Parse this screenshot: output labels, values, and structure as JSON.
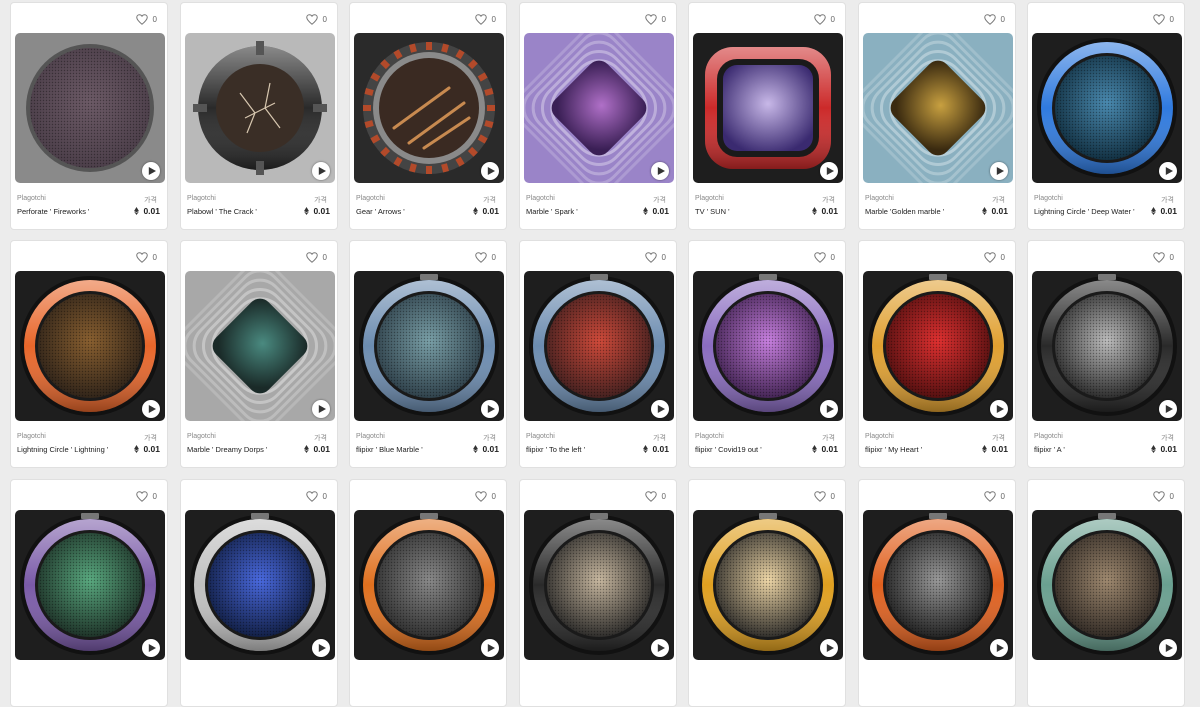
{
  "grid": {
    "items": [
      {
        "likes": "0",
        "creator": "Plagotchi",
        "price_label": "가격",
        "name": "Perforate ' Fireworks '",
        "price": "0.01",
        "style": "perforate",
        "colors": {
          "bg": "#8a8a8a",
          "ring": "#3a3a3a",
          "screen": "#4a3d48",
          "accent": "#6c5a66"
        }
      },
      {
        "likes": "0",
        "creator": "Plagotchi",
        "price_label": "가격",
        "name": "Plabowl ' The Crack '",
        "price": "0.01",
        "style": "bowl",
        "colors": {
          "bg": "#b9b9b9",
          "ring": "#2a2a2a",
          "screen": "#3a2e26",
          "accent": "#d8c8b0"
        }
      },
      {
        "likes": "0",
        "creator": "Plagotchi",
        "price_label": "가격",
        "name": "Gear ' Arrows '",
        "price": "0.01",
        "style": "gear",
        "colors": {
          "bg": "#2a2a2a",
          "ring": "#b34a2a",
          "screen": "#3a2a22",
          "accent": "#c88a50"
        }
      },
      {
        "likes": "0",
        "creator": "Plagotchi",
        "price_label": "가격",
        "name": "Marble ' Spark '",
        "price": "0.01",
        "style": "marble",
        "colors": {
          "bg": "#9a84c8",
          "ring": "#7c64ae",
          "screen": "#3a1f55",
          "accent": "#b070c8"
        }
      },
      {
        "likes": "0",
        "creator": "Plagotchi",
        "price_label": "가격",
        "name": "TV ' SUN '",
        "price": "0.01",
        "style": "tv",
        "colors": {
          "bg": "#1e1e1e",
          "ring": "#cc2a2a",
          "screen": "#3a2a70",
          "accent": "#c8b8e8"
        }
      },
      {
        "likes": "0",
        "creator": "Plagotchi",
        "price_label": "가격",
        "name": "Marble 'Golden marble '",
        "price": "0.01",
        "style": "marble",
        "colors": {
          "bg": "#8ab0c0",
          "ring": "#6a94a8",
          "screen": "#3a2a10",
          "accent": "#c8a040"
        }
      },
      {
        "likes": "0",
        "creator": "Plagotchi",
        "price_label": "가격",
        "name": "Lightning Circle ' Deep Water '",
        "price": "0.01",
        "style": "circle",
        "colors": {
          "bg": "#1e1e1e",
          "ring": "#2f7adf",
          "screen": "#0e2a3a",
          "accent": "#4a8ab0"
        }
      },
      {
        "likes": "0",
        "creator": "Plagotchi",
        "price_label": "가격",
        "name": "Lightning Circle ' Lightning '",
        "price": "0.01",
        "style": "circle",
        "colors": {
          "bg": "#1e1e1e",
          "ring": "#e8662a",
          "screen": "#2a2018",
          "accent": "#8a6030"
        }
      },
      {
        "likes": "0",
        "creator": "Plagotchi",
        "price_label": "가격",
        "name": "Marble ' Dreamy Dorps '",
        "price": "0.01",
        "style": "marble",
        "colors": {
          "bg": "#a8a8a8",
          "ring": "#8a8a8a",
          "screen": "#1a2a28",
          "accent": "#4a8a80"
        }
      },
      {
        "likes": "0",
        "creator": "Plagotchi",
        "price_label": "가격",
        "name": "flipixr ' Blue Marble '",
        "price": "0.01",
        "style": "flipixr",
        "colors": {
          "bg": "#1e1e1e",
          "ring": "#6c8cb0",
          "screen": "#2a3a44",
          "accent": "#7aa0a8"
        }
      },
      {
        "likes": "0",
        "creator": "Plagotchi",
        "price_label": "가격",
        "name": "flipixr ' To the left '",
        "price": "0.01",
        "style": "flipixr",
        "colors": {
          "bg": "#1e1e1e",
          "ring": "#6c8cb0",
          "screen": "#3a1e1e",
          "accent": "#d04a3a"
        }
      },
      {
        "likes": "0",
        "creator": "Plagotchi",
        "price_label": "가격",
        "name": "flipixr ' Covid19 out '",
        "price": "0.01",
        "style": "flipixr",
        "colors": {
          "bg": "#1e1e1e",
          "ring": "#8a6cc0",
          "screen": "#3a1e4a",
          "accent": "#c880e0"
        }
      },
      {
        "likes": "0",
        "creator": "Plagotchi",
        "price_label": "가격",
        "name": "flipixr ' My Heart '",
        "price": "0.01",
        "style": "flipixr",
        "colors": {
          "bg": "#1e1e1e",
          "ring": "#e0a030",
          "screen": "#4a0e0e",
          "accent": "#e03030"
        }
      },
      {
        "likes": "0",
        "creator": "Plagotchi",
        "price_label": "가격",
        "name": "flipixr ' A '",
        "price": "0.01",
        "style": "flipixr",
        "colors": {
          "bg": "#1e1e1e",
          "ring": "#2a2a2a",
          "screen": "#222",
          "accent": "#bdbdbd"
        }
      },
      {
        "likes": "0",
        "style": "flipixr",
        "colors": {
          "bg": "#1e1e1e",
          "ring": "#7a5aa8",
          "screen": "#1a2a22",
          "accent": "#5aaa80"
        }
      },
      {
        "likes": "0",
        "style": "flipixr",
        "colors": {
          "bg": "#1e1e1e",
          "ring": "#c0c0c0",
          "screen": "#0e1a3a",
          "accent": "#4a6ae0"
        }
      },
      {
        "likes": "0",
        "style": "flipixr",
        "colors": {
          "bg": "#1e1e1e",
          "ring": "#e0701e",
          "screen": "#2a2a2a",
          "accent": "#8a8a8a"
        }
      },
      {
        "likes": "0",
        "style": "flipixr",
        "colors": {
          "bg": "#1e1e1e",
          "ring": "#2a2a2a",
          "screen": "#222",
          "accent": "#c8b8a0"
        }
      },
      {
        "likes": "0",
        "style": "flipixr",
        "colors": {
          "bg": "#1e1e1e",
          "ring": "#e0a020",
          "screen": "#222",
          "accent": "#f0d8a8"
        }
      },
      {
        "likes": "0",
        "style": "flipixr",
        "colors": {
          "bg": "#1e1e1e",
          "ring": "#e0601e",
          "screen": "#1a1a1a",
          "accent": "#9a9a9a"
        }
      },
      {
        "likes": "0",
        "style": "flipixr",
        "colors": {
          "bg": "#1e1e1e",
          "ring": "#6aa090",
          "screen": "#2a2420",
          "accent": "#a08a70"
        }
      }
    ]
  }
}
